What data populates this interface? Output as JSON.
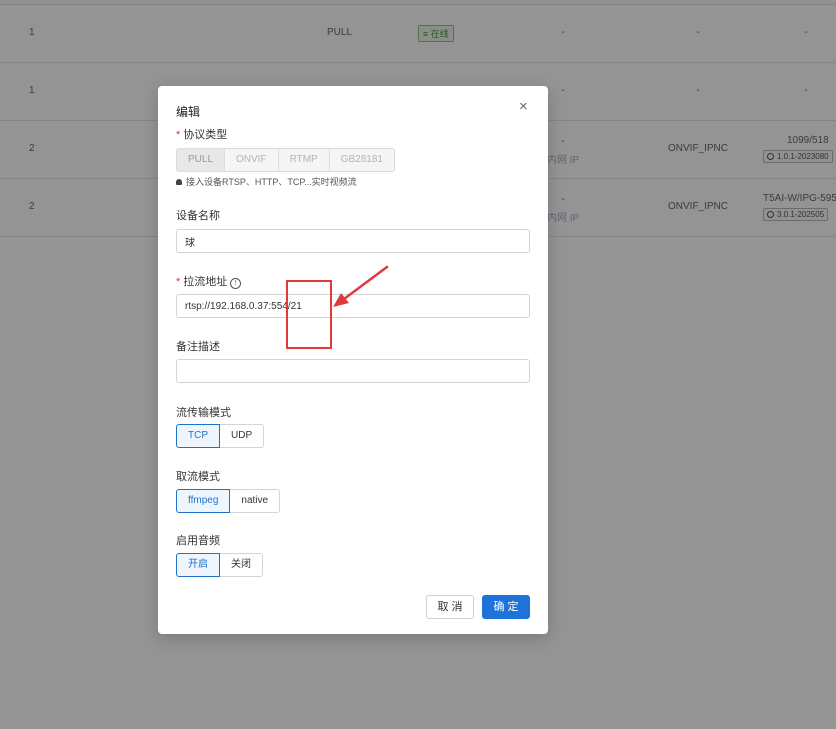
{
  "table": {
    "rows": [
      {
        "col1": "1",
        "protocol": "PULL",
        "status": "≡ 在线",
        "col4": "-",
        "col5": "-",
        "col6": "-"
      },
      {
        "col1": "1",
        "col4": "-",
        "col5": "-",
        "col6": "-"
      },
      {
        "col1": "2",
        "ip_dash": "-",
        "ip_label": "内网 IP",
        "type": "ONVIF_IPNC",
        "model": "1099/518",
        "version": "1.0.1-2023080"
      },
      {
        "col1": "2",
        "ip_dash": "-",
        "ip_label": "内网 IP",
        "type": "ONVIF_IPNC",
        "model": "T5AI-W/IPG-595",
        "version": "3.0.1-202505"
      }
    ]
  },
  "modal": {
    "title": "编辑",
    "close": "×",
    "protocol": {
      "label": "协议类型",
      "options": [
        "PULL",
        "ONVIF",
        "RTMP",
        "GB28181"
      ],
      "selected": "PULL",
      "hint": "接入设备RTSP、HTTP、TCP...实时视频流"
    },
    "device_name": {
      "label": "设备名称",
      "value": "球"
    },
    "pull_url": {
      "label": "拉流地址",
      "info": "!",
      "value": "rtsp://192.168.0.37:554/21"
    },
    "remark": {
      "label": "备注描述",
      "value": ""
    },
    "transport": {
      "label": "流传输模式",
      "options": [
        "TCP",
        "UDP"
      ],
      "selected": "TCP"
    },
    "fetch_mode": {
      "label": "取流模式",
      "options": [
        "ffmpeg",
        "native"
      ],
      "selected": "ffmpeg"
    },
    "audio": {
      "label": "启用音频",
      "options": [
        "开启",
        "关闭"
      ],
      "selected": "开启"
    },
    "cancel_label": "取 消",
    "ok_label": "确 定"
  },
  "colors": {
    "primary": "#1e73d9",
    "required": "#e0322d",
    "annotation": "#e03a3a"
  }
}
